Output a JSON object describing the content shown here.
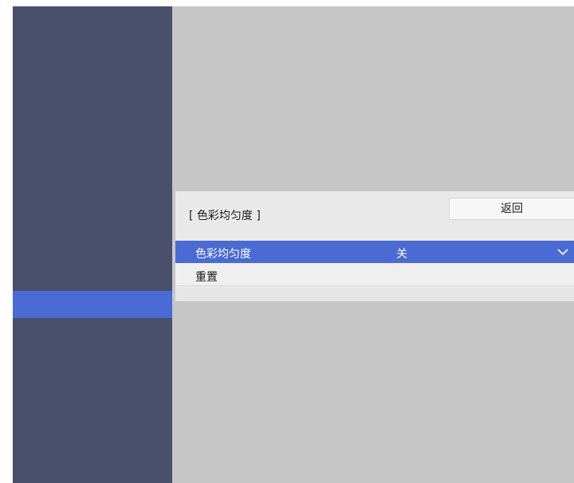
{
  "panel": {
    "title": "[ 色彩均匀度 ]",
    "back_label": "返回"
  },
  "menu": {
    "items": [
      {
        "label": "色彩均匀度",
        "value": "关",
        "icon": "chevron-down-icon",
        "selected": true
      },
      {
        "label": "重置"
      }
    ]
  },
  "colors": {
    "sidebar": "#4a4f6b",
    "accent": "#4a6bd3",
    "background": "#c6c6c6",
    "panel": "#e9e9e9"
  }
}
